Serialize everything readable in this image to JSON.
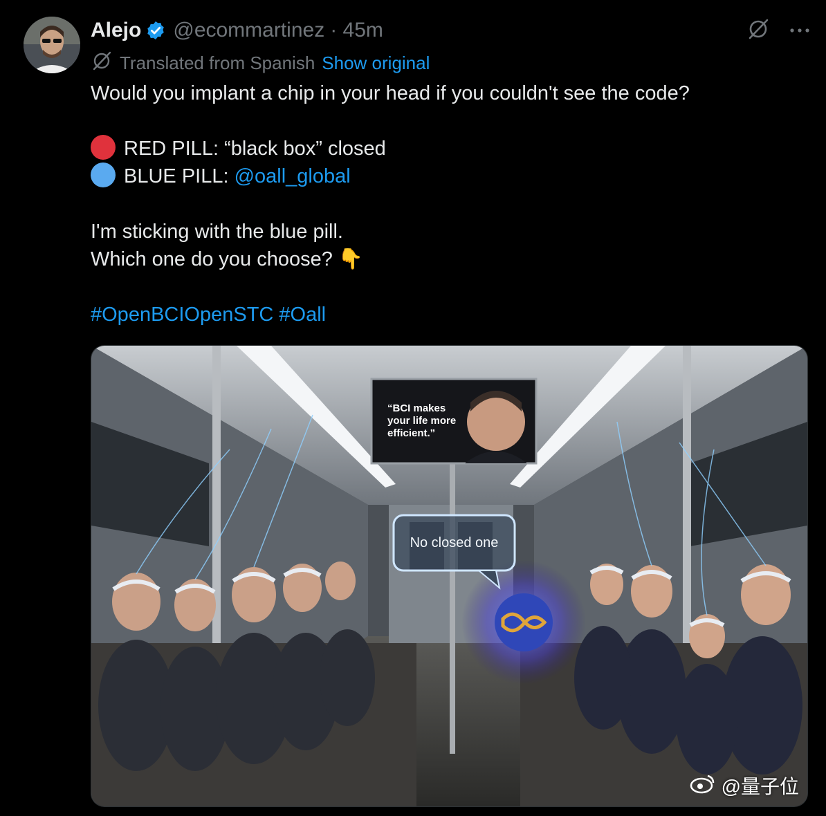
{
  "author": {
    "name": "Alejo",
    "handle": "@ecommartinez",
    "time": "· 45m"
  },
  "translation": {
    "label": "Translated from Spanish",
    "action": "Show original"
  },
  "tweet": {
    "line1": "Would you implant a chip in your head if you couldn't see the code?",
    "red_line": "RED PILL: “black box” closed",
    "blue_prefix": "BLUE PILL:",
    "blue_mention": "@oall_global",
    "line_stick": "I'm sticking with the blue pill.",
    "line_choose": "Which one do you choose?",
    "pointing_emoji": "👇",
    "hashtag1": "#OpenBCIOpenSTC",
    "hashtag2": "#Oall"
  },
  "media": {
    "billboard_text": "“BCI makes your life more efficient.”",
    "bubble_text": "No closed one"
  },
  "watermark": {
    "text": "@量子位"
  },
  "colors": {
    "accent": "#1d9bf0",
    "red_dot": "#e0323c",
    "blue_dot": "#5aaaf0"
  },
  "icons": [
    "grok-slash-icon",
    "more-options-icon",
    "verified-badge-icon",
    "translate-icon",
    "weibo-icon"
  ]
}
